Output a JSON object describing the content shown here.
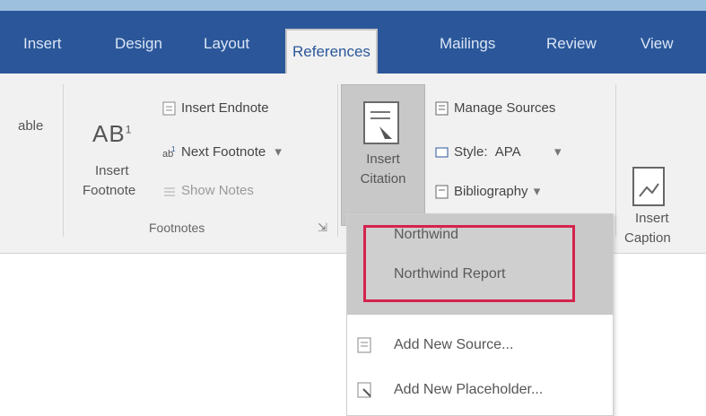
{
  "tabs": [
    {
      "label": "Insert"
    },
    {
      "label": "Design"
    },
    {
      "label": "Layout"
    },
    {
      "label": "References"
    },
    {
      "label": "Mailings"
    },
    {
      "label": "Review"
    },
    {
      "label": "View"
    }
  ],
  "ribbon": {
    "left_cut_label": "able",
    "footnotes": {
      "insert_footnote_icon": "AB",
      "insert_footnote_superscript": "1",
      "insert_footnote_line1": "Insert",
      "insert_footnote_line2": "Footnote",
      "insert_endnote": "Insert Endnote",
      "next_footnote": "Next Footnote",
      "show_notes": "Show Notes",
      "group_label": "Footnotes"
    },
    "citations": {
      "insert_citation_line1": "Insert",
      "insert_citation_line2": "Citation",
      "manage_sources": "Manage Sources",
      "style_label": "Style:",
      "style_value": "APA",
      "bibliography": "Bibliography"
    },
    "captions": {
      "insert_caption_line1": "Insert",
      "insert_caption_line2": "Caption"
    }
  },
  "dropdown": {
    "sources": [
      {
        "label": "Northwind"
      },
      {
        "label": "Northwind Report"
      }
    ],
    "actions": [
      {
        "label": "Add New Source..."
      },
      {
        "label": "Add New Placeholder..."
      }
    ]
  },
  "colors": {
    "ribbon_bg": "#2b579a",
    "highlight": "#d4234d"
  }
}
